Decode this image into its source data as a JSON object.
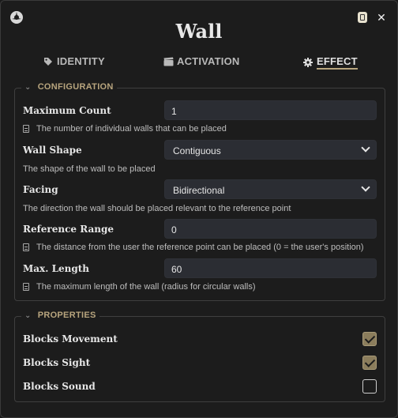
{
  "window": {
    "title": "Wall",
    "close_label": "✕"
  },
  "tabs": [
    {
      "label": "IDENTITY",
      "icon": "tag-icon",
      "active": false
    },
    {
      "label": "ACTIVATION",
      "icon": "clapperboard-icon",
      "active": false
    },
    {
      "label": "EFFECT",
      "icon": "gear-icon",
      "active": true
    }
  ],
  "configuration": {
    "legend": "CONFIGURATION",
    "fields": {
      "max_count": {
        "label": "Maximum Count",
        "value": "1",
        "hint": "The number of individual walls that can be placed"
      },
      "wall_shape": {
        "label": "Wall Shape",
        "value": "Contiguous",
        "hint": "The shape of the wall to be placed"
      },
      "facing": {
        "label": "Facing",
        "value": "Bidirectional",
        "hint": "The direction the wall should be placed relevant to the reference point"
      },
      "reference_range": {
        "label": "Reference Range",
        "value": "0",
        "hint": "The distance from the user the reference point can be placed (0 = the user's position)"
      },
      "max_length": {
        "label": "Max. Length",
        "value": "60",
        "hint": "The maximum length of the wall (radius for circular walls)"
      }
    }
  },
  "properties": {
    "legend": "PROPERTIES",
    "items": [
      {
        "label": "Blocks Movement",
        "checked": true
      },
      {
        "label": "Blocks Sight",
        "checked": true
      },
      {
        "label": "Blocks Sound",
        "checked": false
      }
    ]
  },
  "colors": {
    "accent": "#b8a57e",
    "checkbox_checked": "#8b7d5c",
    "input_bg": "#2b2d33",
    "window_bg": "#1c1c1c"
  }
}
